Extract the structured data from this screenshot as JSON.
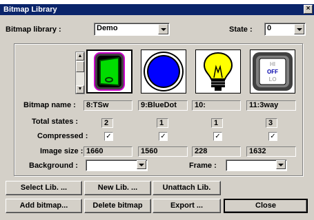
{
  "window": {
    "title": "Bitmap Library",
    "close_glyph": "×"
  },
  "library": {
    "label": "Bitmap library :",
    "value": "Demo"
  },
  "state": {
    "label": "State :",
    "value": "0"
  },
  "bitmaps": [
    {
      "name": "8:TSw",
      "total_states": "2",
      "compressed": true,
      "image_size": "1660",
      "icon": "toggle-switch-icon"
    },
    {
      "name": "9:BlueDot",
      "total_states": "1",
      "compressed": true,
      "image_size": "1560",
      "icon": "blue-dot-icon"
    },
    {
      "name": "10:",
      "total_states": "1",
      "compressed": true,
      "image_size": "228",
      "icon": "light-bulb-icon"
    },
    {
      "name": "11:3way",
      "total_states": "3",
      "compressed": true,
      "image_size": "1632",
      "icon": "three-way-switch-icon"
    }
  ],
  "three_way_labels": [
    "HI",
    "OFF",
    "LO"
  ],
  "labels": {
    "bitmap_name": "Bitmap name :",
    "total_states": "Total states :",
    "compressed": "Compressed :",
    "image_size": "Image size :",
    "background": "Background :",
    "frame": "Frame :"
  },
  "checkmark": "✓",
  "buttons": {
    "select_lib": "Select Lib. ...",
    "new_lib": "New Lib. ...",
    "unattach_lib": "Unattach Lib.",
    "add_bitmap": "Add bitmap...",
    "delete_bitmap": "Delete bitmap",
    "export": "Export ...",
    "close": "Close"
  },
  "colors": {
    "titlebar": "#0a246a",
    "face": "#d4d0c8",
    "toggle_green": "#00dd00",
    "blue_dot": "#0000ff",
    "bulb_yellow": "#ffff00"
  }
}
